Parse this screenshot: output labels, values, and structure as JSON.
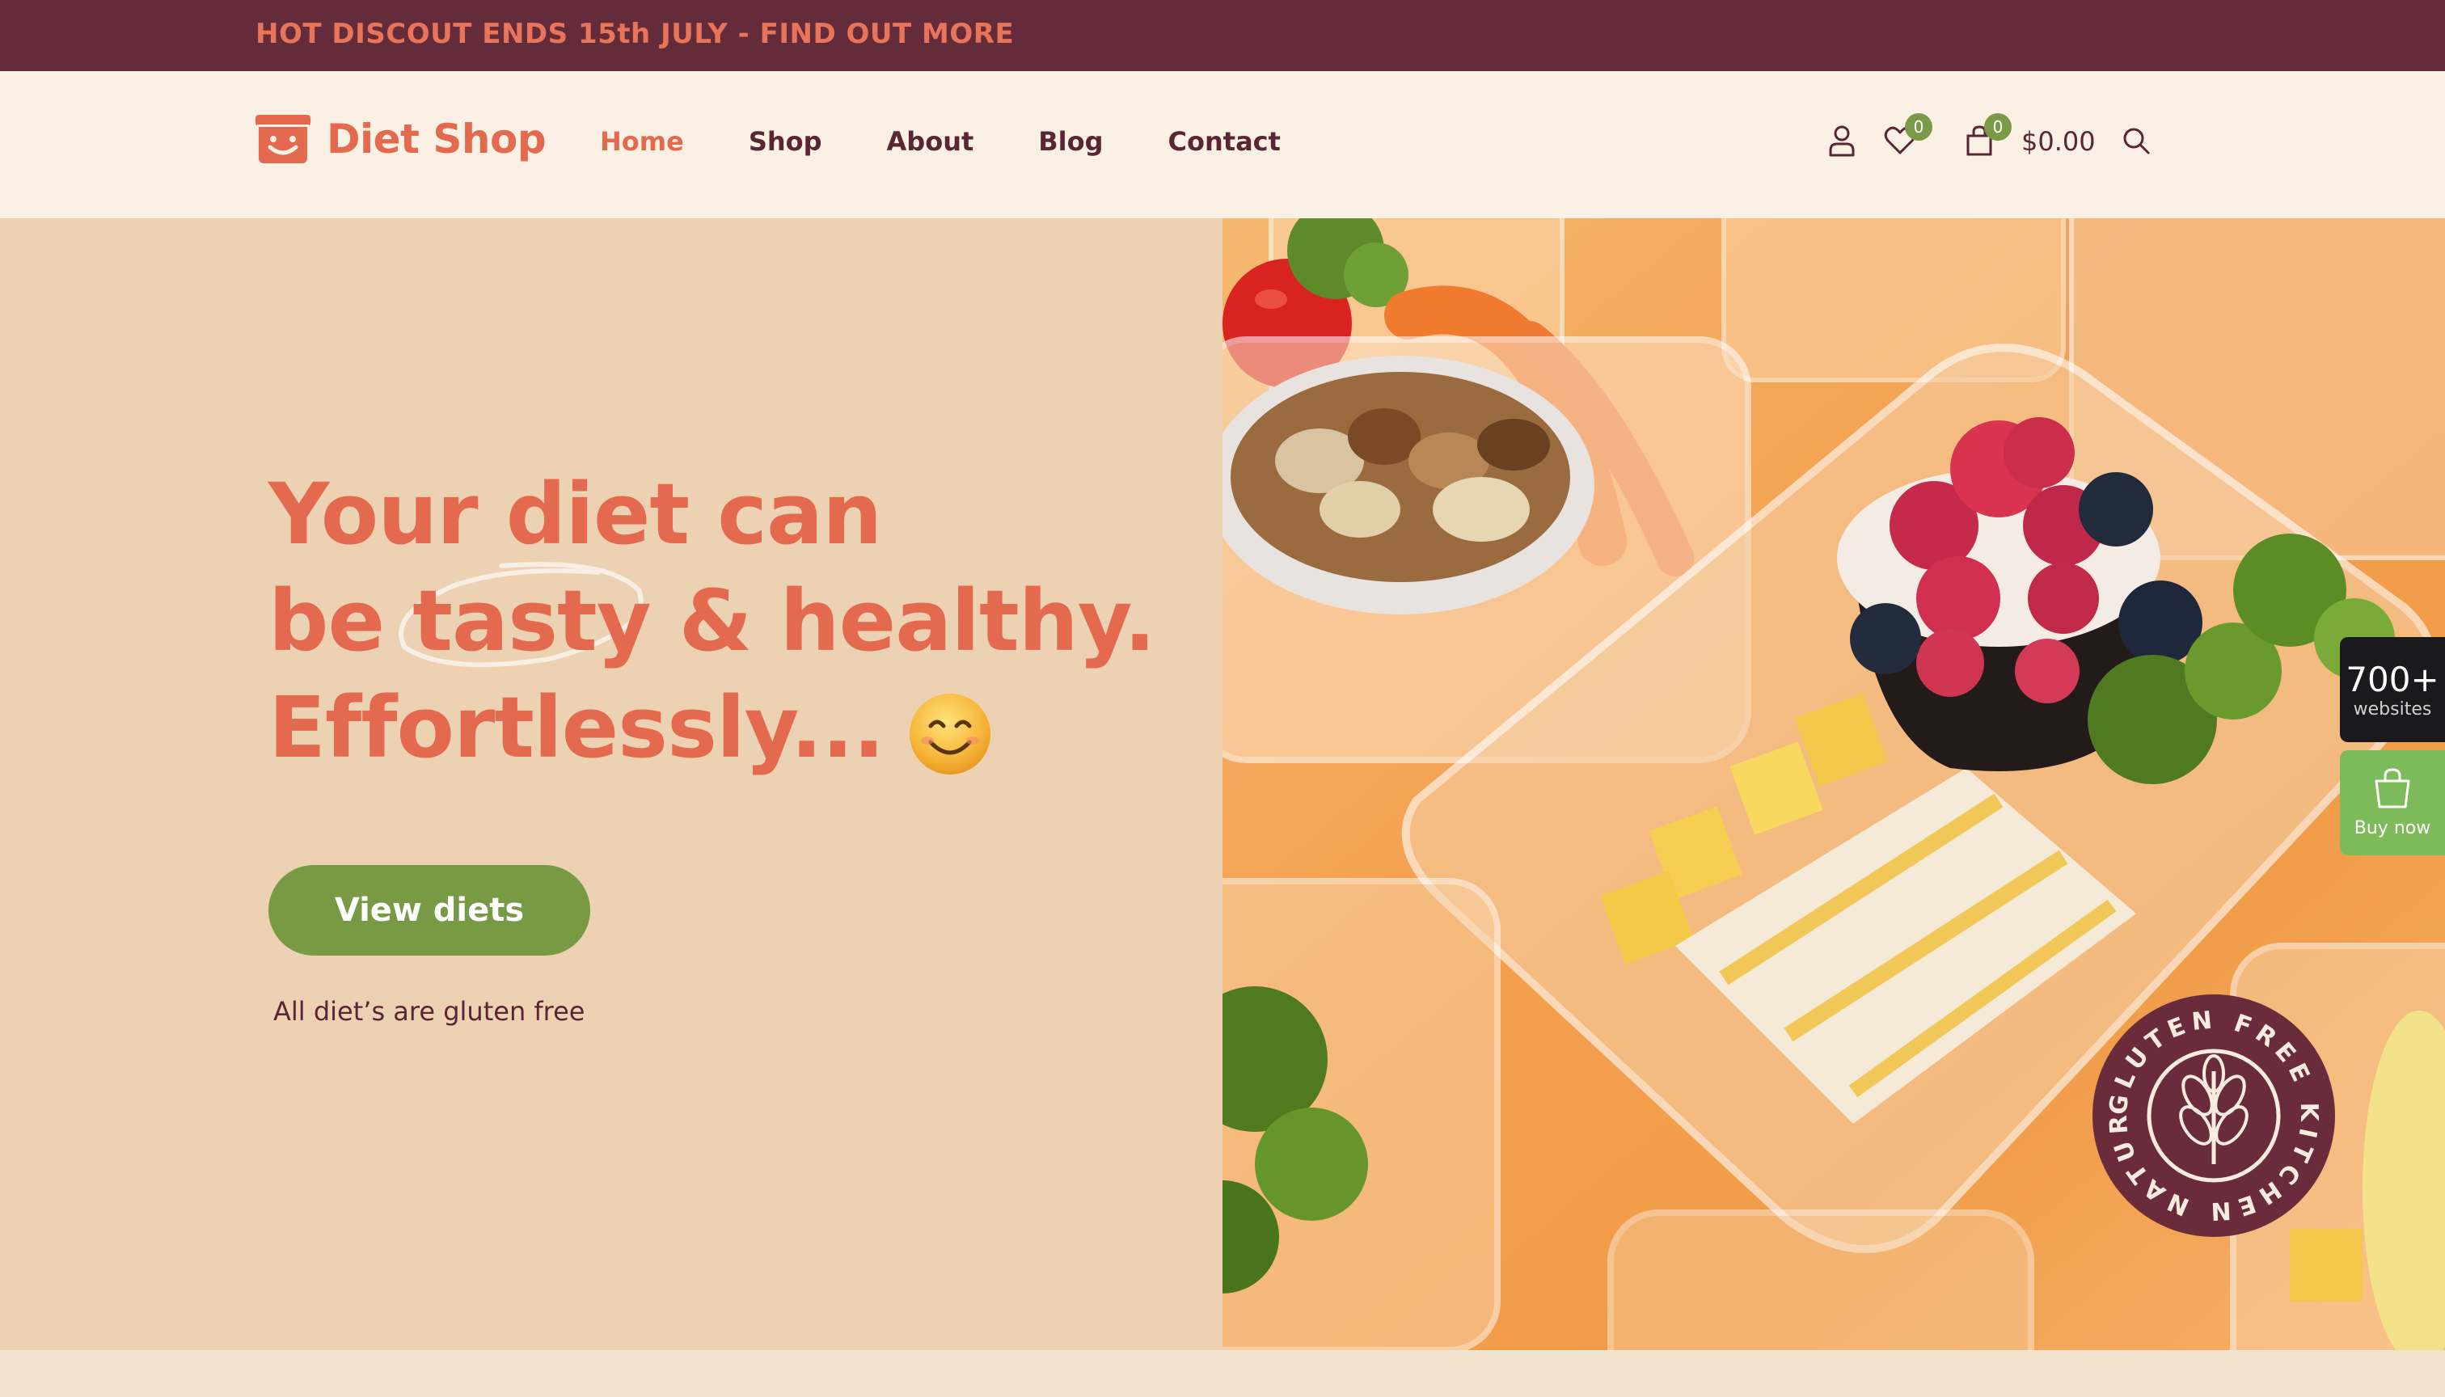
{
  "topbar": {
    "text": "HOT DISCOUT ENDS 15th JULY - FIND OUT MORE"
  },
  "header": {
    "logo_text": "Diet Shop",
    "nav": [
      "Home",
      "Shop",
      "About",
      "Blog",
      "Contact"
    ],
    "active_nav": "Home",
    "wishlist_count": "0",
    "cart_count": "0",
    "cart_total": "$0.00",
    "icons": [
      "user-icon",
      "heart-icon",
      "bag-icon",
      "search-icon"
    ]
  },
  "hero": {
    "headline_1": "Your diet can",
    "headline_2_pre": "be",
    "headline_2_tasty": "tasty",
    "headline_2_post": "& healthy.",
    "headline_3": "Effortlessly...",
    "cta": "View diets",
    "note": "All diet’s are gluten free"
  },
  "badge_seal": {
    "text": "GLUTEN FREE KITCHEN NATURAL"
  },
  "floating": {
    "count": "700+",
    "count_label": "websites",
    "buy_label": "Buy now"
  },
  "colors": {
    "topbar": "#642b3a",
    "accent": "#e36a4e",
    "green": "#789a45",
    "hero_bg": "#ecd1b2",
    "header_bg": "#faf1e4"
  }
}
